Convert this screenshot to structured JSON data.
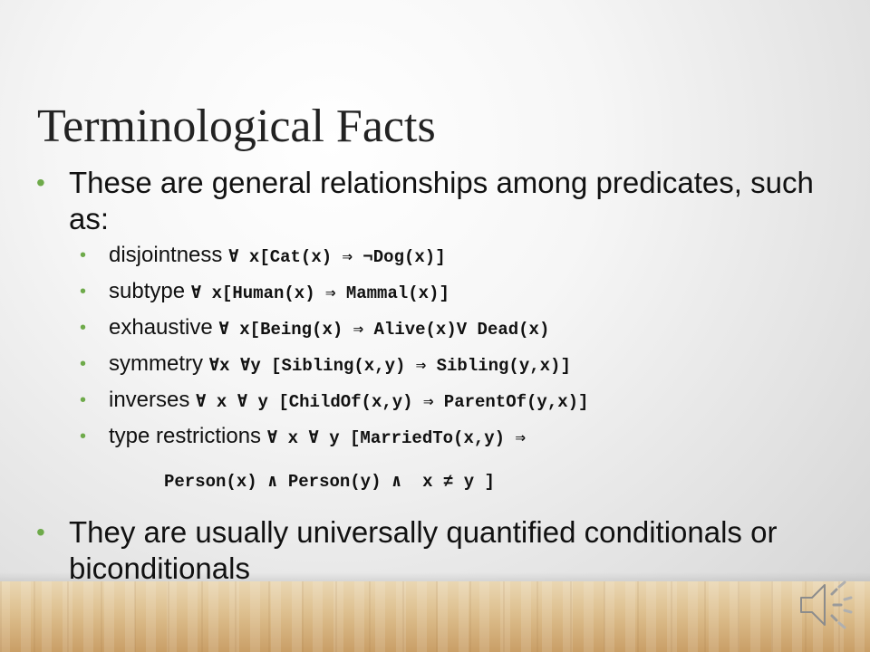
{
  "slide": {
    "title": "Terminological Facts",
    "bullets": {
      "first": "These are general relationships among predicates, such as:",
      "second": "They are usually universally quantified conditionals or biconditionals"
    },
    "sub_items": [
      {
        "label": "disjointness",
        "formula": "∀ x[Cat(x) ⇒ ¬Dog(x)]"
      },
      {
        "label": "subtype",
        "formula": "∀ x[Human(x) ⇒ Mammal(x)]"
      },
      {
        "label": "exhaustive",
        "formula": "∀ x[Being(x) ⇒ Alive(x)V Dead(x)"
      },
      {
        "label": "symmetry",
        "formula": "∀x ∀y [Sibling(x,y) ⇒  Sibling(y,x)]"
      },
      {
        "label": "inverses",
        "formula": "∀ x ∀ y [ChildOf(x,y) ⇒ ParentOf(y,x)]"
      },
      {
        "label": "type restrictions",
        "formula": "∀ x ∀ y [MarriedTo(x,y) ⇒"
      }
    ],
    "type_restrictions_continuation": "Person(x) ∧ Person(y) ∧  x ≠ y ]",
    "bullet_color": "#6eaa4a",
    "audio_icon": "speaker-icon"
  }
}
